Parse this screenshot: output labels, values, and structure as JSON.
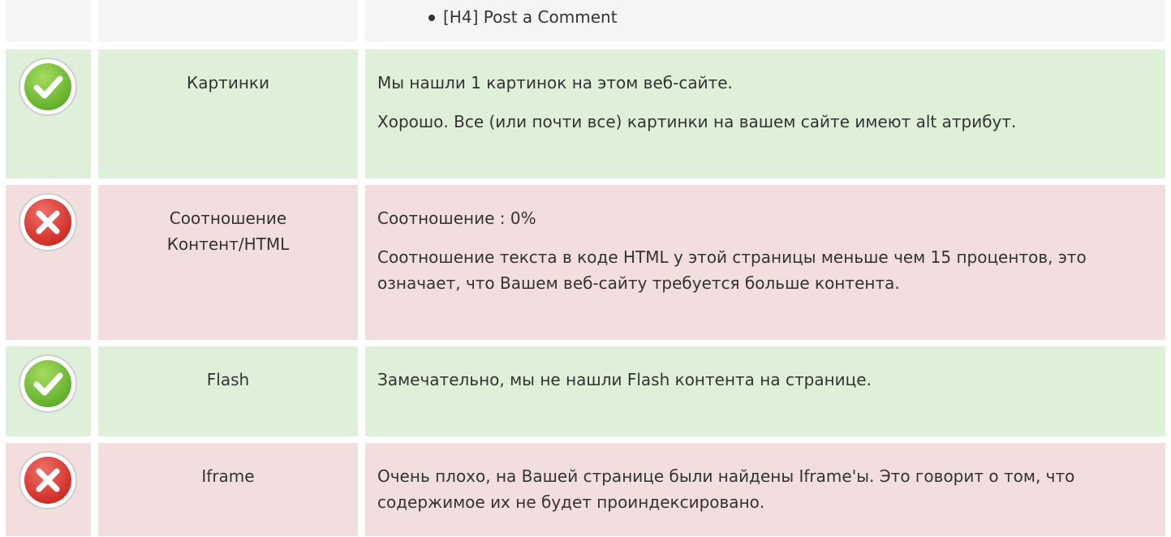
{
  "headings_row": {
    "items": [
      "[H4] Post a Comment"
    ]
  },
  "rows": [
    {
      "status": "ok",
      "icon": "check-icon",
      "label": "Картинки",
      "paragraphs": [
        "Мы нашли 1 картинок на этом веб-сайте.",
        "Хорошо. Все (или почти все) картинки на вашем сайте имеют alt атрибут."
      ]
    },
    {
      "status": "error",
      "icon": "cross-icon",
      "label": "Соотношение Контент/HTML",
      "paragraphs": [
        "Соотношение : 0%",
        "Соотношение текста в коде HTML у этой страницы меньше чем 15 процентов, это означает, что Вашем веб-сайту требуется больше контента."
      ]
    },
    {
      "status": "ok",
      "icon": "check-icon",
      "label": "Flash",
      "paragraphs": [
        "Замечательно, мы не нашли Flash контента на странице."
      ]
    },
    {
      "status": "error",
      "icon": "cross-icon",
      "label": "Iframe",
      "paragraphs": [
        "Очень плохо, на Вашей странице были найдены Iframe'ы. Это говорит о том, что содержимое их не будет проиндексировано."
      ]
    }
  ],
  "colors": {
    "ok_row": "#dff0d8",
    "error_row": "#f2dede",
    "neutral_row": "#f5f5f5",
    "ok_icon": "#7cc23a",
    "error_icon": "#e0312a"
  }
}
